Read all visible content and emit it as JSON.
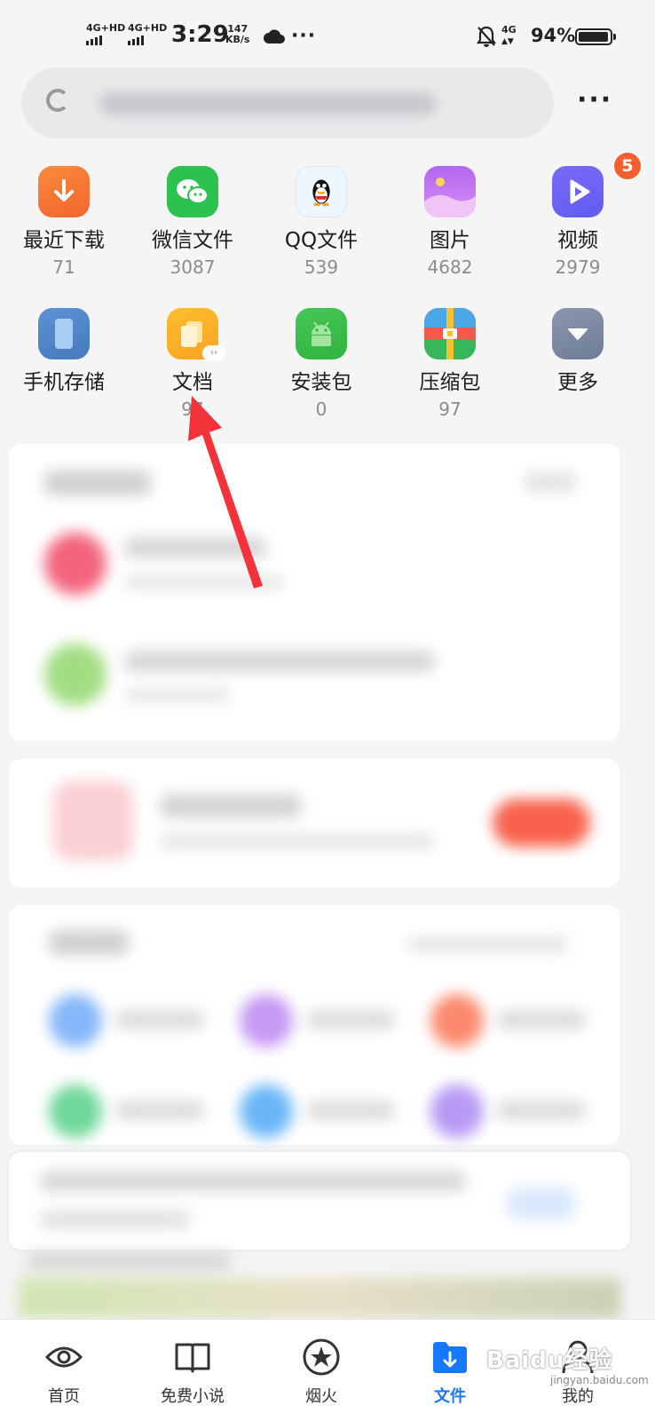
{
  "status_bar": {
    "signal1": "4G+HD",
    "signal2": "4G+HD",
    "time": "3:29",
    "speed_value": "147",
    "speed_unit": "KB/s",
    "network": "4G",
    "battery": "94%",
    "battery_level": 0.94
  },
  "search": {},
  "categories": [
    {
      "label": "最近下载",
      "count": "71",
      "icon": "download-icon",
      "color": "#f97a3a"
    },
    {
      "label": "微信文件",
      "count": "3087",
      "icon": "wechat-icon",
      "color": "#2bc24f"
    },
    {
      "label": "QQ文件",
      "count": "539",
      "icon": "qq-icon",
      "color": "#eef6ff"
    },
    {
      "label": "图片",
      "count": "4682",
      "icon": "image-icon",
      "color": "#c66cf0"
    },
    {
      "label": "视频",
      "count": "2979",
      "icon": "video-icon",
      "color": "#6a63f5",
      "badge": "5"
    },
    {
      "label": "手机存储",
      "count": "",
      "icon": "phone-icon",
      "color": "#4f86c8"
    },
    {
      "label": "文档",
      "count": "97",
      "icon": "document-icon",
      "color": "#fcb026"
    },
    {
      "label": "安装包",
      "count": "0",
      "icon": "android-icon",
      "color": "#39c04a"
    },
    {
      "label": "压缩包",
      "count": "97",
      "icon": "zip-icon",
      "color": "#ef5a4c"
    },
    {
      "label": "更多",
      "count": "",
      "icon": "chevron-down-icon",
      "color": "#7d8ba7"
    }
  ],
  "nav": [
    {
      "label": "首页",
      "icon": "eye-icon"
    },
    {
      "label": "免费小说",
      "icon": "book-icon"
    },
    {
      "label": "烟火",
      "icon": "firework-icon"
    },
    {
      "label": "文件",
      "icon": "folder-download-icon",
      "active": true
    },
    {
      "label": "我的",
      "icon": "profile-icon"
    }
  ],
  "watermark": {
    "text": "Baidu经验",
    "sub": "jingyan.baidu.com"
  }
}
